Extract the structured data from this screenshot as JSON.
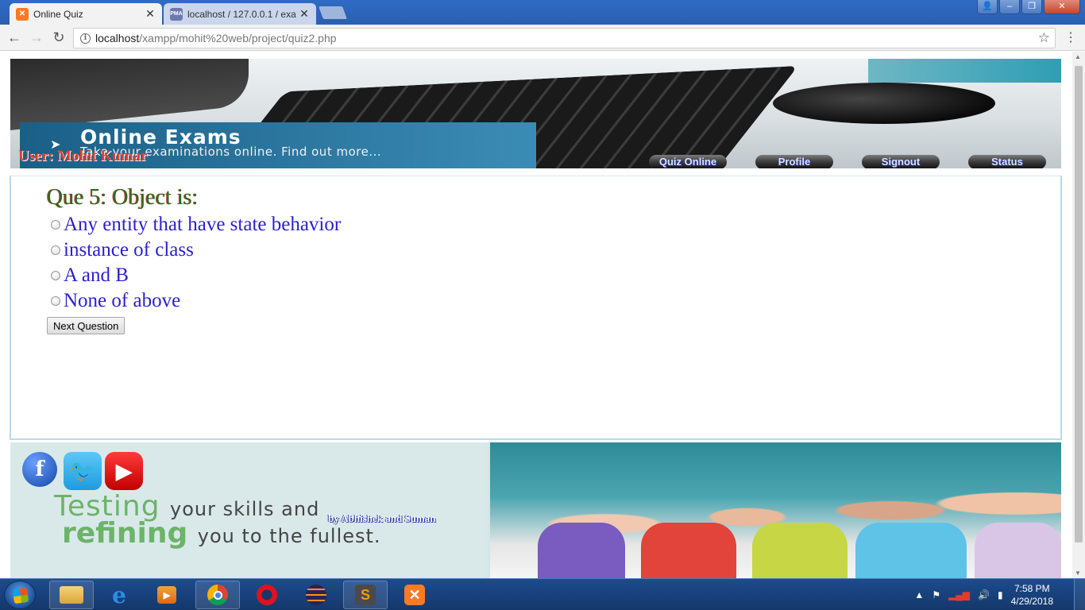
{
  "browser": {
    "tabs": [
      {
        "title": "Online Quiz",
        "active": true
      },
      {
        "title": "localhost / 127.0.0.1 / exa",
        "active": false
      }
    ],
    "url_host": "localhost",
    "url_path": "/xampp/mohit%20web/project/quiz2.php"
  },
  "header": {
    "banner_title": "Online Exams",
    "banner_subtitle": "Take your examinations online. Find out more...",
    "user_label": "User: Mohit Kumar",
    "nav": [
      "Quiz Online",
      "Profile",
      "Signout",
      "Status"
    ]
  },
  "quiz": {
    "question": "Que 5: Object is:",
    "options": [
      "Any entity that have state behavior",
      "instance of class",
      "A and B",
      "None of above"
    ],
    "next_button": "Next Question"
  },
  "footer": {
    "tagline_1a": "Testing",
    "tagline_1b": "your skills and",
    "tagline_2a": "refining",
    "tagline_2b": "you to the fullest.",
    "credit": "by Abhishek and Suman"
  },
  "taskbar": {
    "time": "7:58 PM",
    "date": "4/29/2018"
  },
  "colors": {
    "question": "#2b6a22",
    "option": "#2a1fd0",
    "user_label": "#e23d2a",
    "quiz_border": "#b5dcec"
  }
}
